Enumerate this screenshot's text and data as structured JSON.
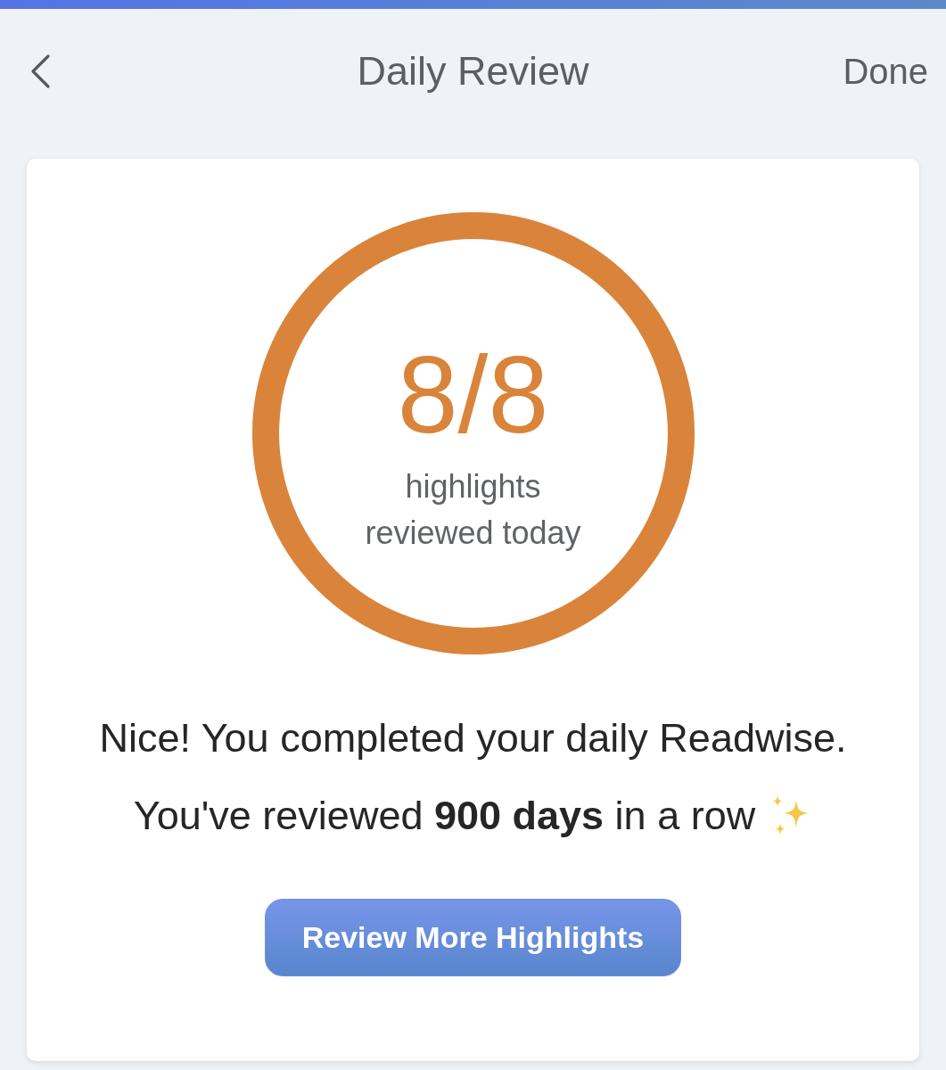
{
  "header": {
    "title": "Daily Review",
    "done": "Done"
  },
  "progress": {
    "count": "8/8",
    "caption": [
      "highlights",
      "reviewed today"
    ],
    "level": 1
  },
  "messages": [
    "Nice! You completed your daily Readwise.",
    "You've reviewed **900 days** in a row"
  ],
  "button": {
    "label": "Review More Highlights"
  }
}
